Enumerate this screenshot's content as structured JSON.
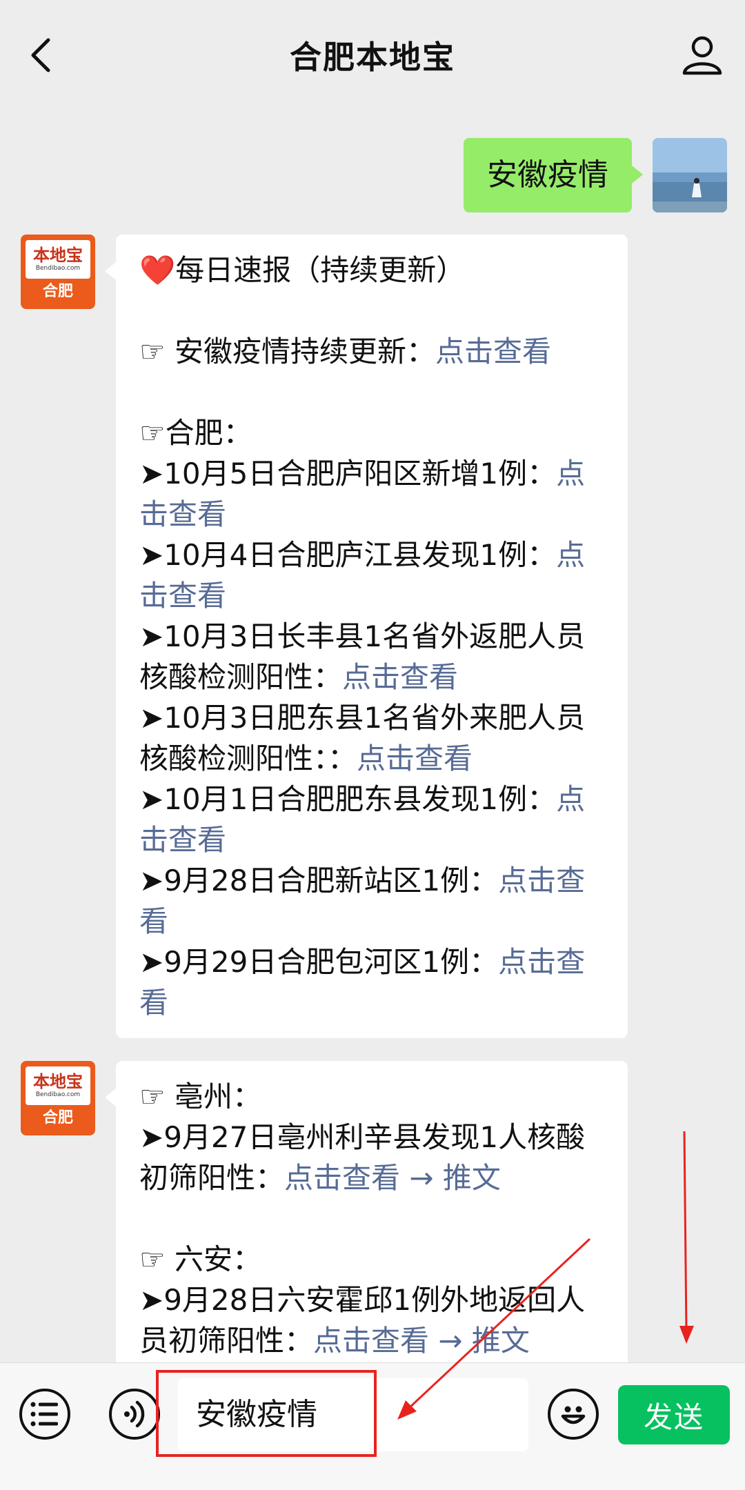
{
  "header": {
    "title": "合肥本地宝",
    "back_icon": "chevron-left-icon",
    "profile_icon": "person-icon"
  },
  "chat": {
    "user_message": "安徽疫情",
    "bot_avatar": {
      "logo_main": "本地宝",
      "logo_sub": "Bendibao.com",
      "logo_city": "合肥"
    },
    "bot_message_1": {
      "lines": [
        {
          "text": "❤️每日速报（持续更新）",
          "link": ""
        },
        {
          "blank": true
        },
        {
          "text": "☞ 安徽疫情持续更新：",
          "link": "点击查看"
        },
        {
          "blank": true
        },
        {
          "text": "☞合肥：",
          "link": ""
        },
        {
          "text": "➤10月5日合肥庐阳区新增1例：",
          "link": "点击查看"
        },
        {
          "text": "➤10月4日合肥庐江县发现1例：",
          "link": "点击查看"
        },
        {
          "text": "➤10月3日长丰县1名省外返肥人员核酸检测阳性：",
          "link": "点击查看"
        },
        {
          "text": "➤10月3日肥东县1名省外来肥人员核酸检测阳性：：",
          "link": "点击查看"
        },
        {
          "text": "➤10月1日合肥肥东县发现1例：",
          "link": "点击查看"
        },
        {
          "text": "➤9月28日合肥新站区1例：",
          "link": "点击查看"
        },
        {
          "text": "➤9月29日合肥包河区1例：",
          "link": "点击查看"
        }
      ]
    },
    "bot_message_2": {
      "lines": [
        {
          "text": "☞ 亳州：",
          "link": ""
        },
        {
          "text": "➤9月27日亳州利辛县发现1人核酸初筛阳性：",
          "link": "点击查看 → 推文"
        },
        {
          "blank": true
        },
        {
          "text": "☞ 六安：",
          "link": ""
        },
        {
          "text": "➤9月28日六安霍邱1例外地返回人员初筛阳性：",
          "link": "点击查看 → 推文"
        }
      ]
    }
  },
  "input_bar": {
    "menu_icon": "list-menu-icon",
    "voice_icon": "voice-icon",
    "input_value": "安徽疫情",
    "emoji_icon": "emoji-icon",
    "send_label": "发送"
  },
  "colors": {
    "my_bubble": "#95ec69",
    "link": "#576b95",
    "send": "#07c160",
    "annotation": "#e8231f"
  }
}
